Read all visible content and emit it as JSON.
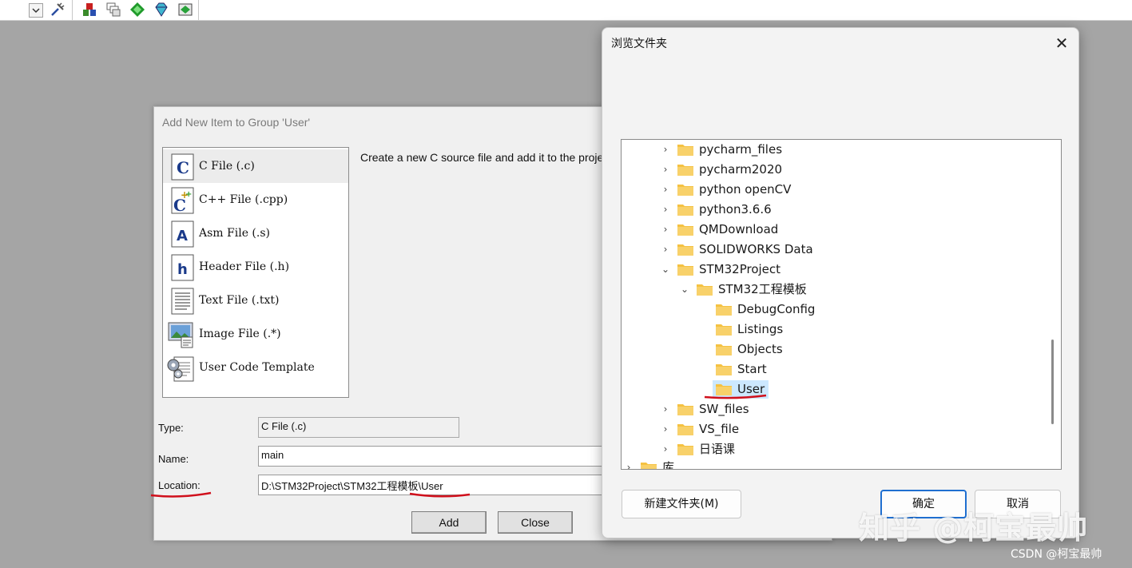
{
  "add_dialog": {
    "title": "Add New Item to Group 'User'",
    "items": [
      {
        "label": "C File (.c)",
        "icon": "c-file-icon",
        "glyph": "C"
      },
      {
        "label": "C++ File (.cpp)",
        "icon": "cpp-file-icon",
        "glyph": "C"
      },
      {
        "label": "Asm File (.s)",
        "icon": "asm-file-icon",
        "glyph": "A"
      },
      {
        "label": "Header File (.h)",
        "icon": "header-file-icon",
        "glyph": "h"
      },
      {
        "label": "Text File (.txt)",
        "icon": "text-file-icon",
        "glyph": ""
      },
      {
        "label": "Image File (.*)",
        "icon": "image-file-icon",
        "glyph": ""
      },
      {
        "label": "User Code Template",
        "icon": "code-template-icon",
        "glyph": ""
      }
    ],
    "selected_index": 0,
    "description": "Create a new C source file and add it to the project.",
    "type_label": "Type:",
    "type_value": "C File (.c)",
    "name_label": "Name:",
    "name_value": "main",
    "location_label": "Location:",
    "location_value": "D:\\STM32Project\\STM32工程模板\\User",
    "add_button": "Add",
    "close_button": "Close"
  },
  "browse_dialog": {
    "title": "浏览文件夹",
    "close_glyph": "✕",
    "tree": [
      {
        "name": "pycharm_files",
        "level": 0,
        "expander": "collapsed"
      },
      {
        "name": "pycharm2020",
        "level": 0,
        "expander": "collapsed"
      },
      {
        "name": "python openCV",
        "level": 0,
        "expander": "collapsed"
      },
      {
        "name": "python3.6.6",
        "level": 0,
        "expander": "collapsed"
      },
      {
        "name": "QMDownload",
        "level": 0,
        "expander": "collapsed"
      },
      {
        "name": "SOLIDWORKS Data",
        "level": 0,
        "expander": "collapsed"
      },
      {
        "name": "STM32Project",
        "level": 0,
        "expander": "expanded"
      },
      {
        "name": "STM32工程模板",
        "level": 1,
        "expander": "expanded"
      },
      {
        "name": "DebugConfig",
        "level": 2,
        "expander": "none"
      },
      {
        "name": "Listings",
        "level": 2,
        "expander": "none"
      },
      {
        "name": "Objects",
        "level": 2,
        "expander": "none"
      },
      {
        "name": "Start",
        "level": 2,
        "expander": "none"
      },
      {
        "name": "User",
        "level": 2,
        "expander": "none",
        "selected": true
      },
      {
        "name": "SW_files",
        "level": 0,
        "expander": "collapsed"
      },
      {
        "name": "VS_file",
        "level": 0,
        "expander": "collapsed"
      },
      {
        "name": "日语课",
        "level": 0,
        "expander": "collapsed"
      },
      {
        "name": "库",
        "level": -1,
        "expander": "collapsed"
      }
    ],
    "new_folder_button": "新建文件夹(M)",
    "ok_button": "确定",
    "cancel_button": "取消"
  },
  "watermark": "知乎 @柯宝最帅",
  "credit": "CSDN @柯宝最帅",
  "colors": {
    "annotation_red": "#d0101c",
    "folder_yellow": "#f5c242",
    "selection_blue": "#cce8ff",
    "primary_border": "#1f6fd0"
  }
}
